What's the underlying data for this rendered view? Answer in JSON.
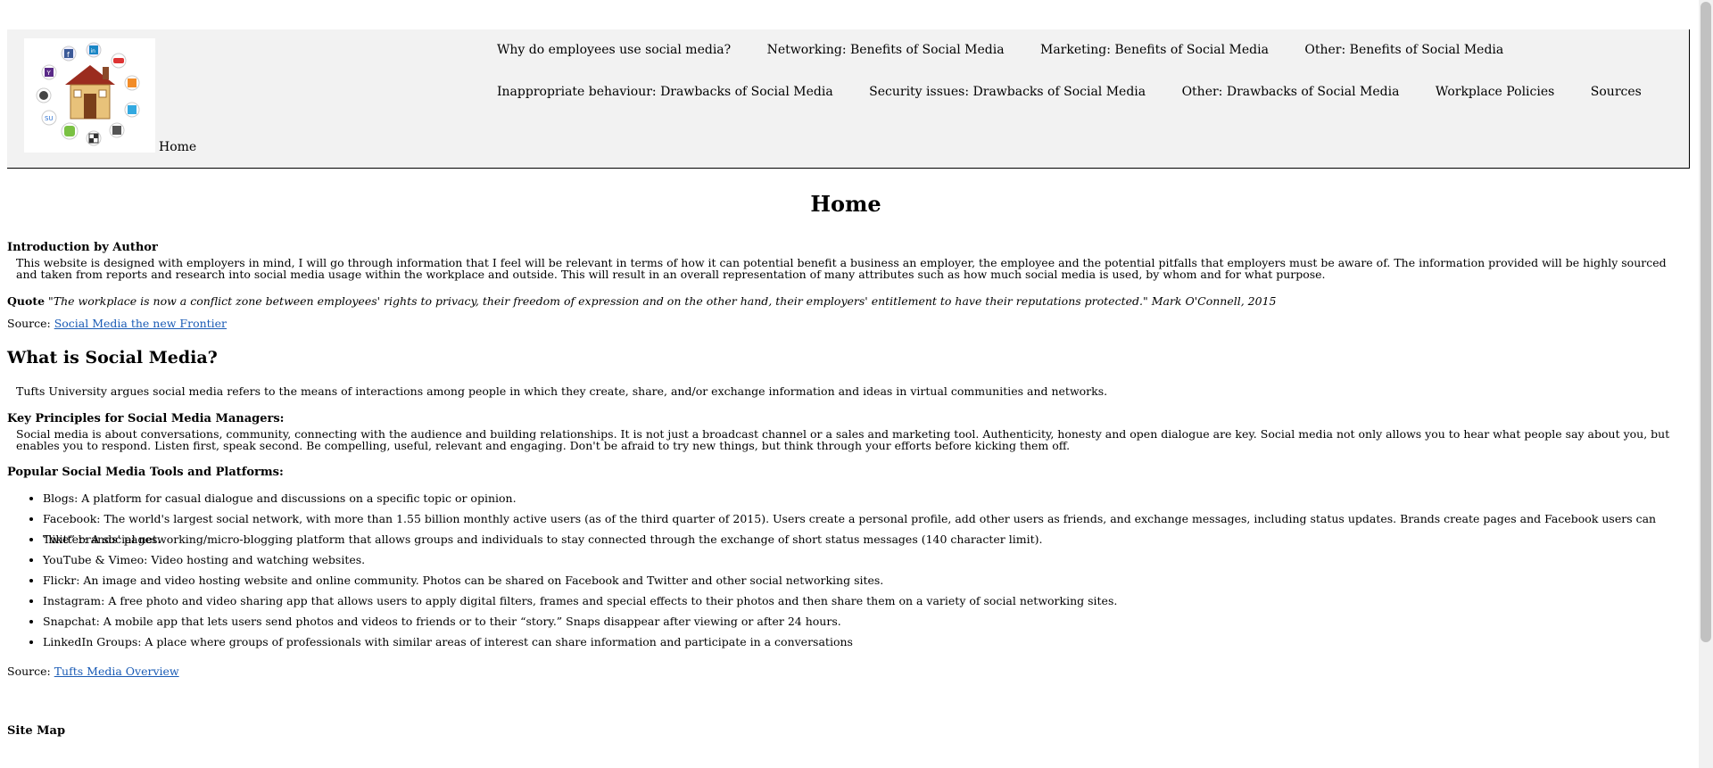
{
  "header": {
    "home_crumb": "Home",
    "nav_row1": [
      "Why do employees use social media?",
      "Networking: Benefits of Social Media",
      "Marketing: Benefits of Social Media",
      "Other: Benefits of Social Media"
    ],
    "nav_row2": [
      "Inappropriate behaviour: Drawbacks of Social Media",
      "Security issues: Drawbacks of Social Media",
      "Other: Drawbacks of Social Media",
      "Workplace Policies",
      "Sources"
    ]
  },
  "main": {
    "title": "Home",
    "intro_label": "Introduction by Author",
    "intro_text": "This website is designed with employers in mind, I will go through information that I feel will be relevant in terms of how it can potential benefit a business an employer, the employee and the potential pitfalls that employers must be aware of. The information provided will be highly sourced and taken from reports and research into social media usage within the workplace and outside. This will result in an overall representation of many attributes such as how much social media is used, by whom and for what purpose.",
    "quote_label": "Quote",
    "quote_text": "\"The workplace is now a conflict zone between employees' rights to privacy, their freedom of expression and on the other hand, their employers' entitlement to have their reputations protected.\" Mark O'Connell, 2015",
    "source1_label": "Source:",
    "source1_link": "Social Media the new Frontier",
    "section_heading": "What is Social Media?",
    "tufts_text": "Tufts University argues social media refers to the means of interactions among people in which they create, share, and/or exchange information and ideas in virtual communities and networks.",
    "key_principles_label": "Key Principles for Social Media Managers:",
    "key_principles_text": "Social media is about conversations, community, connecting with the audience and building relationships. It is not just a broadcast channel or a sales and marketing tool. Authenticity, honesty and open dialogue are key. Social media not only allows you to hear what people say about you, but enables you to respond. Listen first, speak second. Be compelling, useful, relevant and engaging. Don't be afraid to try new things, but think through your efforts before kicking them off.",
    "tools_label": "Popular Social Media Tools and Platforms:",
    "tools": [
      "Blogs: A platform for casual dialogue and discussions on a specific topic or opinion.",
      "Facebook: The world's largest social network, with more than 1.55 billion monthly active users (as of the third quarter of 2015). Users create a personal profile, add other users as friends, and exchange messages, including status updates. Brands create pages and Facebook users can “like” brands' pages.",
      "Twitter: A social networking/micro-blogging platform that allows groups and individuals to stay connected through the exchange of short status messages (140 character limit).",
      "YouTube & Vimeo: Video hosting and watching websites.",
      "Flickr: An image and video hosting website and online community. Photos can be shared on Facebook and Twitter and other social networking sites.",
      "Instagram: A free photo and video sharing app that allows users to apply digital filters, frames and special effects to their photos and then share them on a variety of social networking sites.",
      "Snapchat: A mobile app that lets users send photos and videos to friends or to their “story.” Snaps disappear after viewing or after 24 hours.",
      "LinkedIn Groups: A place where groups of professionals with similar areas of interest can share information and participate in a conversations"
    ],
    "source2_label": "Source:",
    "source2_link": "Tufts Media Overview",
    "sitemap_label": "Site Map"
  },
  "logo": {
    "icons": [
      "facebook-icon",
      "linkedin-icon",
      "youtube-icon",
      "yahoo-icon",
      "rss-icon",
      "wordpress-icon",
      "twitter-icon",
      "stumbleupon-icon",
      "delicious-icon",
      "technorati-icon",
      "myspace-icon"
    ]
  }
}
